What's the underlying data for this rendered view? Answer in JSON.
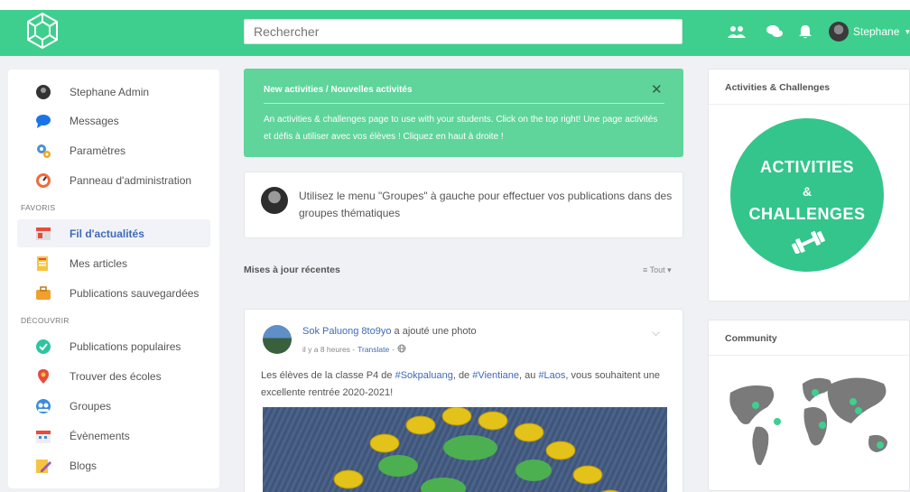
{
  "topbar": {
    "search_placeholder": "Rechercher",
    "user_name": "Stephane",
    "brand_color": "#3ecf8e"
  },
  "sidebar": {
    "profile": {
      "label": "Stephane Admin",
      "icon": "user-avatar"
    },
    "items": [
      {
        "label": "Messages",
        "icon": "chat-bubble-icon"
      },
      {
        "label": "Paramètres",
        "icon": "gears-icon"
      },
      {
        "label": "Panneau d'administration",
        "icon": "gauge-icon"
      }
    ],
    "favoris_title": "FAVORIS",
    "favoris": [
      {
        "label": "Fil d'actualités",
        "icon": "news-feed-icon",
        "active": true
      },
      {
        "label": "Mes articles",
        "icon": "articles-icon"
      },
      {
        "label": "Publications sauvegardées",
        "icon": "briefcase-icon"
      }
    ],
    "decouvrir_title": "DÉCOUVRIR",
    "decouvrir": [
      {
        "label": "Publications populaires",
        "icon": "popular-icon"
      },
      {
        "label": "Trouver des écoles",
        "icon": "location-pin-icon"
      },
      {
        "label": "Groupes",
        "icon": "groups-icon"
      },
      {
        "label": "Évènements",
        "icon": "calendar-icon"
      },
      {
        "label": "Blogs",
        "icon": "blog-icon"
      }
    ]
  },
  "notice": {
    "title": "New activities / Nouvelles activités",
    "close_label": "✕",
    "body": "An activities & challenges page to use with your students. Click on the top right! Une page activités et défis à utiliser avec vos élèves ! Cliquez en haut à droite !"
  },
  "hint": {
    "text": "Utilisez le menu \"Groupes\" à gauche pour effectuer vos publications dans des groupes thématiques"
  },
  "feed": {
    "section_title": "Mises à jour récentes",
    "sort_label": "≡ Tout ▾"
  },
  "post": {
    "author": "Sok Paluong 8to9yo",
    "action": " a ajouté une photo",
    "time": "il y a 8 heures -",
    "translate": "Translate",
    "dash": "-",
    "caret": "⌵",
    "text_parts": {
      "p1": "Les élèves de la classe P4 de ",
      "t1": "#Sokpaluang",
      "p2": ", de ",
      "t2": "#Vientiane",
      "p3": ", au ",
      "t3": "#Laos",
      "p4": ", vous souhaitent une excellente rentrée 2020-2021!"
    }
  },
  "right": {
    "activities_title": "Activities & Challenges",
    "circle": {
      "line1": "ACTIVITIES",
      "line2": "&",
      "line3": "CHALLENGES"
    },
    "community_title": "Community"
  }
}
